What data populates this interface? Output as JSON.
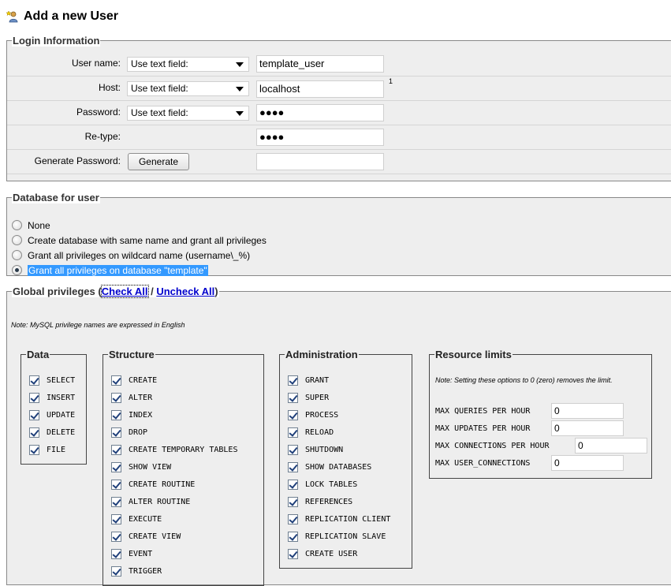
{
  "page": {
    "title": "Add a new User"
  },
  "login": {
    "legend": "Login Information",
    "rows": [
      {
        "label": "User name:",
        "select": "Use text field:",
        "value": "template_user"
      },
      {
        "label": "Host:",
        "select": "Use text field:",
        "value": "localhost",
        "footnote": "1"
      },
      {
        "label": "Password:",
        "select": "Use text field:",
        "value": "●●●●"
      },
      {
        "label": "Re-type:",
        "value": "●●●●"
      },
      {
        "label": "Generate Password:",
        "button": "Generate",
        "value": ""
      }
    ]
  },
  "database": {
    "legend": "Database for user",
    "options": [
      {
        "label": "None",
        "selected": false
      },
      {
        "label": "Create database with same name and grant all privileges",
        "selected": false
      },
      {
        "label": "Grant all privileges on wildcard name (username\\_%)",
        "selected": false
      },
      {
        "label": "Grant all privileges on database \"template\"",
        "selected": true
      }
    ]
  },
  "global": {
    "legend": "Global privileges",
    "open_paren": "(",
    "check_all": "Check All",
    "separator": " / ",
    "uncheck_all": "Uncheck All",
    "close_paren": ")",
    "note": "Note: MySQL privilege names are expressed in English",
    "groups": {
      "data": {
        "legend": "Data",
        "items": [
          "SELECT",
          "INSERT",
          "UPDATE",
          "DELETE",
          "FILE"
        ]
      },
      "structure": {
        "legend": "Structure",
        "items": [
          "CREATE",
          "ALTER",
          "INDEX",
          "DROP",
          "CREATE TEMPORARY TABLES",
          "SHOW VIEW",
          "CREATE ROUTINE",
          "ALTER ROUTINE",
          "EXECUTE",
          "CREATE VIEW",
          "EVENT",
          "TRIGGER"
        ]
      },
      "administration": {
        "legend": "Administration",
        "items": [
          "GRANT",
          "SUPER",
          "PROCESS",
          "RELOAD",
          "SHUTDOWN",
          "SHOW DATABASES",
          "LOCK TABLES",
          "REFERENCES",
          "REPLICATION CLIENT",
          "REPLICATION SLAVE",
          "CREATE USER"
        ]
      },
      "resource": {
        "legend": "Resource limits",
        "note": "Note: Setting these options to 0 (zero) removes the limit.",
        "items": [
          {
            "label": "MAX QUERIES PER HOUR",
            "value": "0"
          },
          {
            "label": "MAX UPDATES PER HOUR",
            "value": "0"
          },
          {
            "label": "MAX CONNECTIONS PER HOUR",
            "value": "0"
          },
          {
            "label": "MAX USER_CONNECTIONS",
            "value": "0"
          }
        ]
      }
    }
  },
  "icons": {
    "title_icon": "add-user-icon"
  }
}
